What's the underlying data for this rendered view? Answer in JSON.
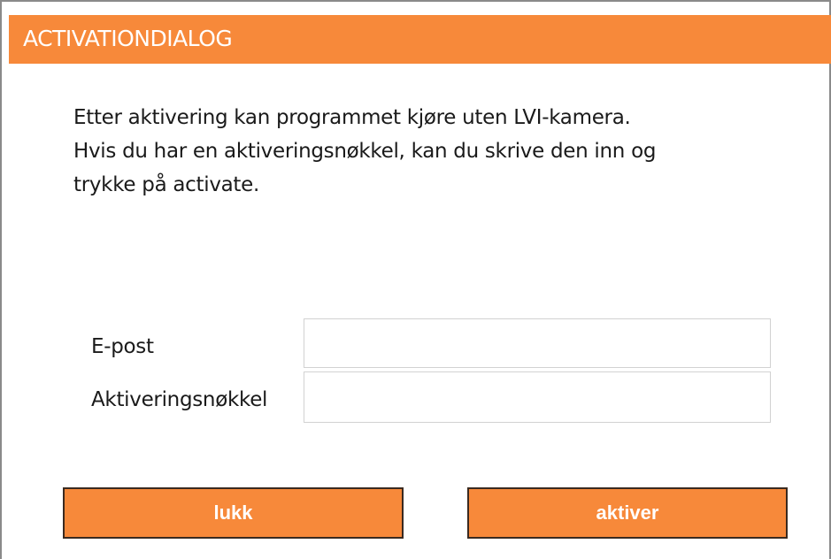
{
  "dialog": {
    "title": "ACTIVATIONDIALOG",
    "message_lines": [
      "Etter aktivering kan programmet kjøre uten LVI-kamera.",
      "Hvis du har en aktiveringsnøkkel, kan du skrive den inn og",
      "trykke på activate."
    ]
  },
  "form": {
    "email_label": "E-post",
    "email_value": "",
    "key_label": "Aktiveringsnøkkel",
    "key_value": ""
  },
  "buttons": {
    "close_label": "lukk",
    "activate_label": "aktiver"
  },
  "colors": {
    "accent": "#f7893a",
    "text": "#1a1a1a",
    "button_text": "#ffffff"
  }
}
